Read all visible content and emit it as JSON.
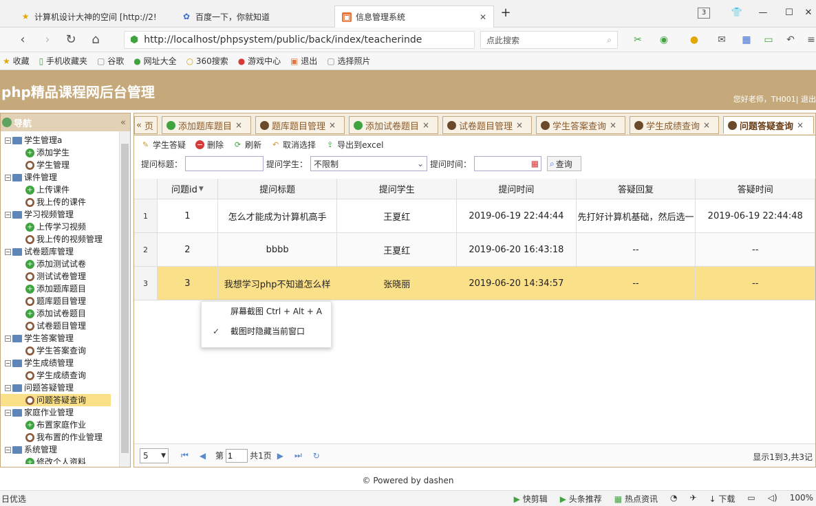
{
  "browser": {
    "tabs": [
      {
        "label": "计算机设计大神的空间 [http://2!",
        "icon": "star-icon",
        "active": false
      },
      {
        "label": "百度一下，你就知道",
        "icon": "paw-icon",
        "active": false
      },
      {
        "label": "信息管理系统",
        "icon": "app-icon",
        "active": true
      }
    ],
    "new_tab": "+",
    "tab_count": "3",
    "url": "http://localhost/phpsystem/public/back/index/teacherinde",
    "search_placeholder": "点此搜索",
    "bookmarks": [
      "收藏",
      "手机收藏夹",
      "谷歌",
      "网址大全",
      "360搜索",
      "游戏中心",
      "退出",
      "选择照片"
    ]
  },
  "app": {
    "title": "php精品课程网后台管理",
    "welcome": "您好老师，TH001| 退出"
  },
  "sidebar": {
    "title": "导航",
    "collapse": "«",
    "groups": [
      {
        "label": "学生管理a",
        "items": [
          {
            "label": "添加学生",
            "icon": "add"
          },
          {
            "label": "学生管理",
            "icon": "user"
          }
        ]
      },
      {
        "label": "课件管理",
        "items": [
          {
            "label": "上传课件",
            "icon": "add"
          },
          {
            "label": "我上传的课件",
            "icon": "user"
          }
        ]
      },
      {
        "label": "学习视频管理",
        "items": [
          {
            "label": "上传学习视频",
            "icon": "add"
          },
          {
            "label": "我上传的视频管理",
            "icon": "user"
          }
        ]
      },
      {
        "label": "试卷题库管理",
        "items": [
          {
            "label": "添加测试试卷",
            "icon": "add"
          },
          {
            "label": "测试试卷管理",
            "icon": "user"
          },
          {
            "label": "添加题库题目",
            "icon": "add"
          },
          {
            "label": "题库题目管理",
            "icon": "user"
          },
          {
            "label": "添加试卷题目",
            "icon": "add"
          },
          {
            "label": "试卷题目管理",
            "icon": "user"
          }
        ]
      },
      {
        "label": "学生答案管理",
        "items": [
          {
            "label": "学生答案查询",
            "icon": "user"
          }
        ]
      },
      {
        "label": "学生成绩管理",
        "items": [
          {
            "label": "学生成绩查询",
            "icon": "user"
          }
        ]
      },
      {
        "label": "问题答疑管理",
        "items": [
          {
            "label": "问题答疑查询",
            "icon": "user",
            "selected": true
          }
        ]
      },
      {
        "label": "家庭作业管理",
        "items": [
          {
            "label": "布置家庭作业",
            "icon": "add"
          },
          {
            "label": "我布置的作业管理",
            "icon": "user"
          }
        ]
      },
      {
        "label": "系统管理",
        "items": [
          {
            "label": "修改个人资料",
            "icon": "add"
          }
        ]
      }
    ]
  },
  "main_tabs": {
    "scroll_left": "«",
    "stub": "页",
    "items": [
      {
        "label": "添加题库题目",
        "icon": "add"
      },
      {
        "label": "题库题目管理",
        "icon": "user"
      },
      {
        "label": "添加试卷题目",
        "icon": "add"
      },
      {
        "label": "试卷题目管理",
        "icon": "user"
      },
      {
        "label": "学生答案查询",
        "icon": "user"
      },
      {
        "label": "学生成绩查询",
        "icon": "user"
      },
      {
        "label": "问题答疑查询",
        "icon": "user",
        "active": true
      }
    ],
    "close": "×"
  },
  "toolbar": {
    "answer": "学生答疑",
    "delete": "删除",
    "refresh": "刷新",
    "cancel": "取消选择",
    "export": "导出到excel"
  },
  "filter": {
    "title_label": "提问标题：",
    "student_label": "提问学生：",
    "student_value": "不限制",
    "time_label": "提问时间：",
    "query": "查询"
  },
  "grid": {
    "columns": [
      "问题id",
      "提问标题",
      "提问学生",
      "提问时间",
      "答疑回复",
      "答疑时间"
    ],
    "rows": [
      {
        "rn": "1",
        "cells": [
          "1",
          "怎么才能成为计算机高手",
          "王夏红",
          "2019-06-19 22:44:44",
          "先打好计算机基础，然后选一",
          "2019-06-19 22:44:48"
        ]
      },
      {
        "rn": "2",
        "cells": [
          "2",
          "bbbb",
          "王夏红",
          "2019-06-20 16:43:18",
          "--",
          "--"
        ]
      },
      {
        "rn": "3",
        "cells": [
          "3",
          "我想学习php不知道怎么样",
          "张晓丽",
          "2019-06-20 14:34:57",
          "--",
          "--"
        ],
        "selected": true
      }
    ]
  },
  "pager": {
    "page_size": "5",
    "page_prefix": "第",
    "page_value": "1",
    "page_total": "共1页",
    "info": "显示1到3,共3记"
  },
  "context_menu": {
    "items": [
      {
        "label": "屏幕截图 Ctrl + Alt + A",
        "checked": false
      },
      {
        "label": "截图时隐藏当前窗口",
        "checked": true
      }
    ]
  },
  "footer": "© Powered by dashen",
  "status": {
    "left": "日优选",
    "items": [
      "快剪辑",
      "头条推荐",
      "热点资讯",
      "下载",
      "100%"
    ]
  },
  "colors": {
    "brand": "#c6a97a",
    "selected_row": "#fbe08a",
    "tab_text": "#8a5b2c"
  }
}
